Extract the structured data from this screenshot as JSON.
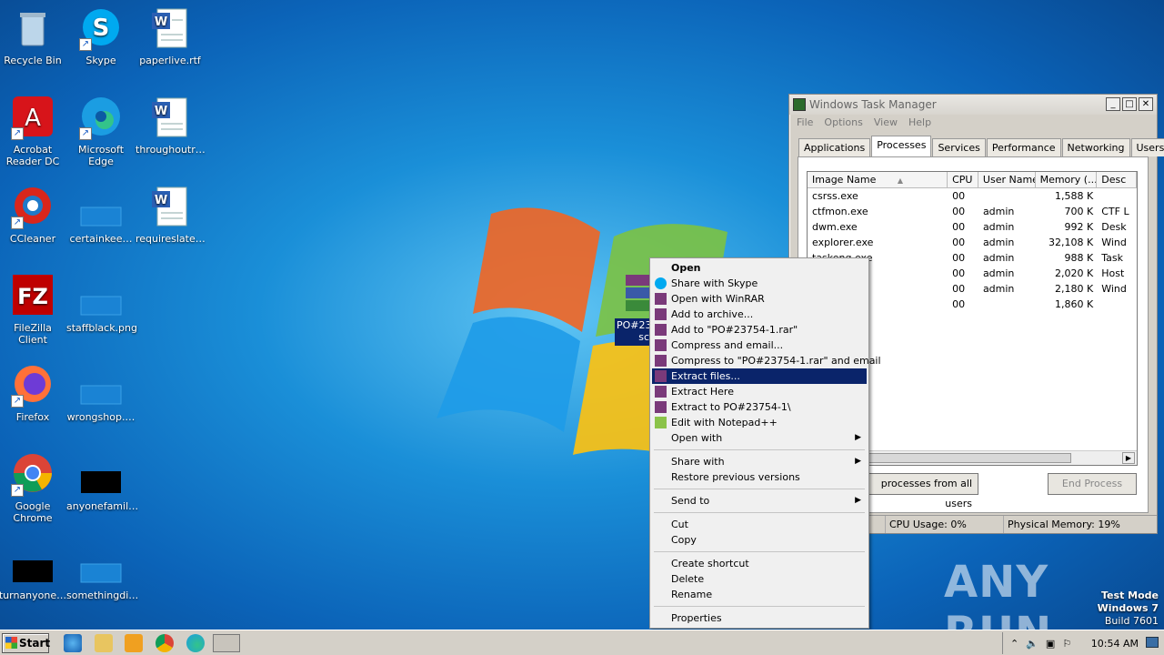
{
  "desktop": {
    "icons": [
      {
        "label": "Recycle Bin",
        "icon": "recycle-bin-icon"
      },
      {
        "label": "Skype",
        "icon": "skype-icon"
      },
      {
        "label": "paperlive.rtf",
        "icon": "word-doc-icon"
      },
      {
        "label": "Acrobat Reader DC",
        "icon": "acrobat-icon"
      },
      {
        "label": "Microsoft Edge",
        "icon": "edge-icon"
      },
      {
        "label": "throughoutr…",
        "icon": "word-doc-icon"
      },
      {
        "label": "CCleaner",
        "icon": "ccleaner-icon"
      },
      {
        "label": "certainkee…",
        "icon": "blank-file-icon"
      },
      {
        "label": "requireslate…",
        "icon": "word-doc-icon"
      },
      {
        "label": "FileZilla Client",
        "icon": "filezilla-icon"
      },
      {
        "label": "staffblack.png",
        "icon": "image-file-icon"
      },
      {
        "label": "Firefox",
        "icon": "firefox-icon"
      },
      {
        "label": "wrongshop.…",
        "icon": "blank-file-icon"
      },
      {
        "label": "Google Chrome",
        "icon": "chrome-icon"
      },
      {
        "label": "anyonefamil…",
        "icon": "black-file-icon"
      },
      {
        "label": "turnanyone…",
        "icon": "black-file-icon"
      },
      {
        "label": "somethingdi…",
        "icon": "blank-file-icon"
      }
    ],
    "selected_file_label": "PO#23754-1",
    "selected_file_label_line1": "PO#23",
    "selected_file_label_line2": "sc"
  },
  "task_manager": {
    "title": "Windows Task Manager",
    "menu": [
      "File",
      "Options",
      "View",
      "Help"
    ],
    "tabs": [
      "Applications",
      "Processes",
      "Services",
      "Performance",
      "Networking",
      "Users"
    ],
    "active_tab": "Processes",
    "columns": [
      "Image Name",
      "CPU",
      "User Name",
      "Memory (...",
      "Desc"
    ],
    "rows": [
      {
        "name": "csrss.exe",
        "cpu": "00",
        "user": "",
        "mem": "1,588 K",
        "desc": ""
      },
      {
        "name": "ctfmon.exe",
        "cpu": "00",
        "user": "admin",
        "mem": "700 K",
        "desc": "CTF L"
      },
      {
        "name": "dwm.exe",
        "cpu": "00",
        "user": "admin",
        "mem": "992 K",
        "desc": "Desk"
      },
      {
        "name": "explorer.exe",
        "cpu": "00",
        "user": "admin",
        "mem": "32,108 K",
        "desc": "Wind"
      },
      {
        "name": "taskeng.exe",
        "cpu": "00",
        "user": "admin",
        "mem": "988 K",
        "desc": "Task"
      },
      {
        "name": "",
        "cpu": "00",
        "user": "admin",
        "mem": "2,020 K",
        "desc": "Host"
      },
      {
        "name": "",
        "cpu": "00",
        "user": "admin",
        "mem": "2,180 K",
        "desc": "Wind"
      },
      {
        "name": "",
        "cpu": "00",
        "user": "",
        "mem": "1,860 K",
        "desc": ""
      }
    ],
    "show_all_label": "processes from all users",
    "end_process_label": "End Process",
    "status": {
      "cpu": "CPU Usage: 0%",
      "memory": "Physical Memory: 19%"
    }
  },
  "context_menu": {
    "items": [
      {
        "label": "Open",
        "bold": true
      },
      {
        "label": "Share with Skype",
        "icon": "skype-icon"
      },
      {
        "label": "Open with WinRAR",
        "icon": "winrar-icon"
      },
      {
        "label": "Add to archive...",
        "icon": "winrar-icon"
      },
      {
        "label": "Add to \"PO#23754-1.rar\"",
        "icon": "winrar-icon"
      },
      {
        "label": "Compress and email...",
        "icon": "winrar-icon"
      },
      {
        "label": "Compress to \"PO#23754-1.rar\" and email",
        "icon": "winrar-icon"
      },
      {
        "label": "Extract files...",
        "icon": "winrar-icon",
        "highlighted": true
      },
      {
        "label": "Extract Here",
        "icon": "winrar-icon"
      },
      {
        "label": "Extract to PO#23754-1\\",
        "icon": "winrar-icon"
      },
      {
        "label": "Edit with Notepad++",
        "icon": "notepadpp-icon"
      },
      {
        "label": "Open with",
        "submenu": true
      },
      {
        "separator": true
      },
      {
        "label": "Share with",
        "submenu": true
      },
      {
        "label": "Restore previous versions"
      },
      {
        "separator": true
      },
      {
        "label": "Send to",
        "submenu": true
      },
      {
        "separator": true
      },
      {
        "label": "Cut"
      },
      {
        "label": "Copy"
      },
      {
        "separator": true
      },
      {
        "label": "Create shortcut"
      },
      {
        "label": "Delete"
      },
      {
        "label": "Rename"
      },
      {
        "separator": true
      },
      {
        "label": "Properties"
      }
    ]
  },
  "taskbar": {
    "start_label": "Start",
    "clock": "10:54 AM"
  },
  "watermark": {
    "line1": "Test Mode",
    "line2": "Windows 7",
    "line3": "Build 7601",
    "brand": "ANY RUN"
  }
}
